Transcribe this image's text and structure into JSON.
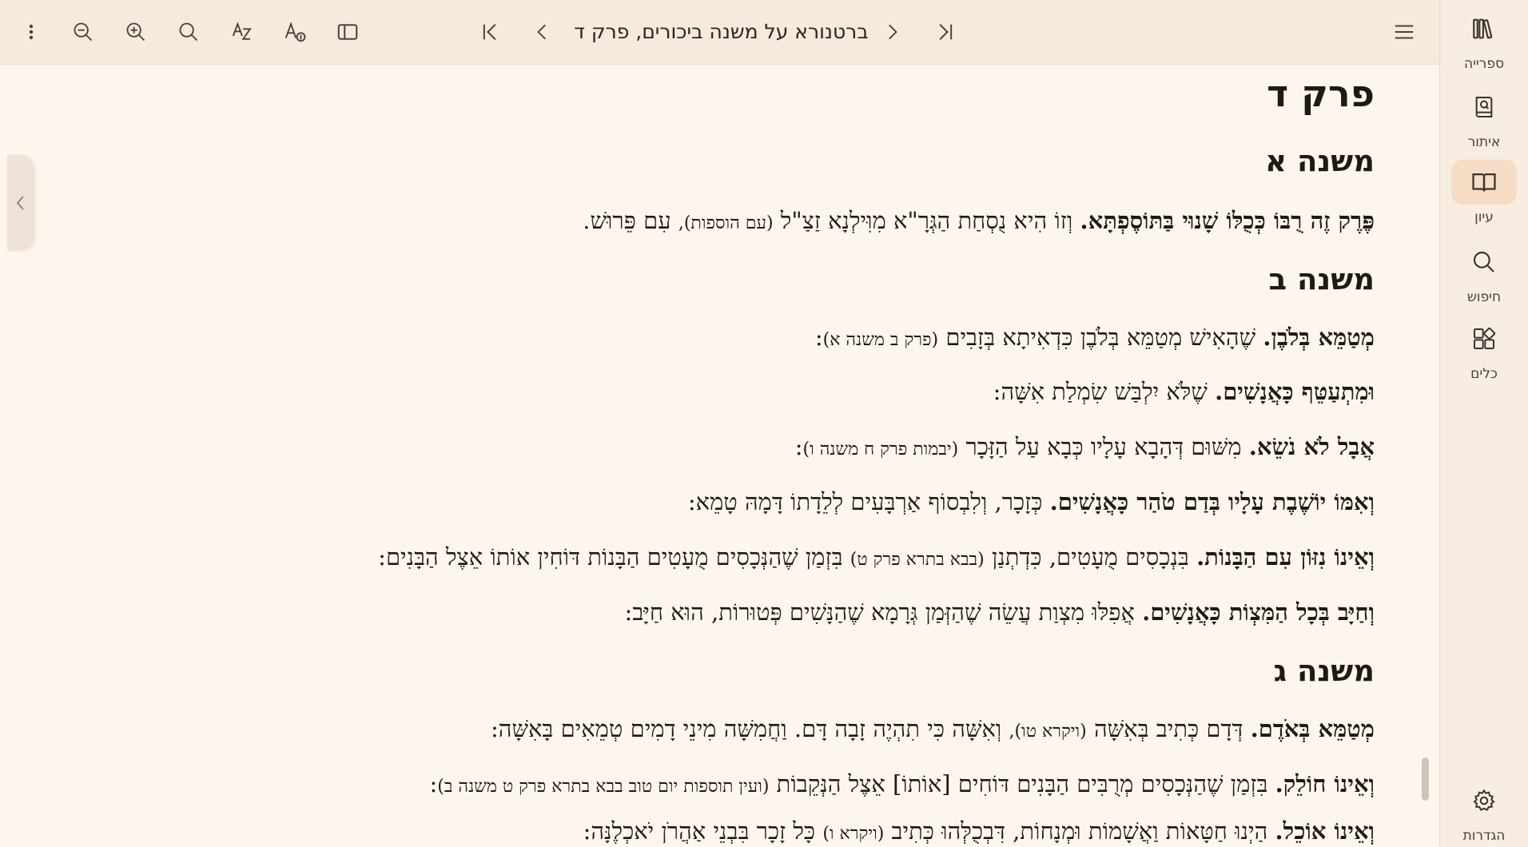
{
  "toolbar": {
    "title": "ברטנורא על משנה ביכורים, פרק ד",
    "buttons": [
      "more-menu",
      "zoom-out",
      "zoom-in",
      "search",
      "spell-tool",
      "font-size",
      "toggle-panel",
      "first-page",
      "previous",
      "next",
      "last-page",
      "hamburger-menu"
    ]
  },
  "sidebar": {
    "items": [
      {
        "label": "ספרייה",
        "icon": "library-icon"
      },
      {
        "label": "איתור",
        "icon": "locate-icon"
      },
      {
        "label": "עיון",
        "icon": "book-open-icon"
      },
      {
        "label": "חיפוש",
        "icon": "search-icon"
      },
      {
        "label": "כלים",
        "icon": "tools-icon"
      },
      {
        "label": "הגדרות",
        "icon": "gear-icon"
      }
    ],
    "active": "עיון"
  },
  "content": {
    "chapter": "פרק ד",
    "sections": [
      {
        "heading": "משנה א",
        "paras": [
          {
            "lead": "פֶּרֶק זֶה רֻבּוֹ כְּכֻלּוֹ שָׁנוּי בַּתּוֹסֶפְתָּא.",
            "text": " וְזוֹ הִיא נֻסְחַת הַגְּרָ\"א מִוִּילְנָא זַצַ\"ל ",
            "ref": "(עם הוספות),",
            "tail": " עִם פֵּרוּשׁ."
          }
        ]
      },
      {
        "heading": "משנה ב",
        "paras": [
          {
            "lead": "מְטַמֵּא בְּלֹבֶן.",
            "text": " שֶׁהָאִישׁ מְטַמֵּא בְּלֹבֶן כִּדְאִיתָא בְּזָבִים ",
            "ref": "(פרק ב משנה א)",
            "tail": ":"
          },
          {
            "lead": "וּמִתְעַטֵּף כָּאֲנָשִׁים.",
            "text": " שֶׁלֹּא יִלְבַּשׁ שִׂמְלַת אִשָּׁה:",
            "ref": "",
            "tail": ""
          },
          {
            "lead": "אֲבָל לֹא נֹשֵׂא.",
            "text": " מִשּׁוּם דְּהָבָא עָלָיו כְּבָא עַל הַזָּכָר ",
            "ref": "(יבמות פרק ח משנה ו)",
            "tail": ":"
          },
          {
            "lead": "וְאִמּוֹ יוֹשֶׁבֶת עָלָיו בְּדַם טֹהַר כָּאֲנָשִׁים.",
            "text": " כְּזָכָר, וְלִבְסוֹף אַרְבָּעִים לְלֵדָתוֹ דָּמָהּ טָמֵא:",
            "ref": "",
            "tail": ""
          },
          {
            "lead": "וְאֵינוֹ נִזּוֹן עִם הַבָּנוֹת.",
            "text": " בִּנְכָסִים מֻעָטִים, כִּדְתְנַן ",
            "ref": "(בבא בתרא פרק ט)",
            "tail": " בִּזְמַן שֶׁהַנְּכָסִים מֻעָטִים הַבָּנוֹת דּוֹחִין אוֹתוֹ אֵצֶל הַבָּנִים:"
          },
          {
            "lead": "וְחַיָּב בְּכָל הַמִּצְוֹת כָּאֲנָשִׁים.",
            "text": " אֲפִלּוּ מִצְוַת עֲשֵׂה שֶׁהַזְּמַן גְּרָמָא שֶׁהַנָּשִׁים פְּטוּרוֹת, הוּא חַיָּב:",
            "ref": "",
            "tail": ""
          }
        ]
      },
      {
        "heading": "משנה ג",
        "paras": [
          {
            "lead": "מְטַמֵּא בְּאֹדֶם.",
            "text": " דְּדָם כְּתִיב בְּאִשָּׁה ",
            "ref": "(ויקרא טו),",
            "tail": " וְאִשָּׁה כִּי תִהְיֶה זָבָה דָּם. וַחֲמִשָּׁה מִינֵי דָמִים טְמֵאִים בָּאִשָּׁה:"
          },
          {
            "lead": "וְאֵינוֹ חוֹלֵק.",
            "text": " בִּזְמַן שֶׁהַנְּכָסִים מְרֻבִּים הַבָּנִים דּוֹחִים [אוֹתוֹ] אֵצֶל הַנְּקֵבוֹת ",
            "ref": "(ועין תוספות יום טוב בבא בתרא פרק ט משנה ב)",
            "tail": ":"
          },
          {
            "lead": "וְאֵינוֹ אוֹכֵל.",
            "text": " הַיְנוּ חַטָּאוֹת וַאֲשָׁמוֹת וּמְנָחוֹת, דִּבְכֻלְּהוּ כְּתִיב ",
            "ref": "(ויקרא ו)",
            "tail": " כָּל זָכָר בִּבְנֵי אַהֲרֹן יֹאכְלֶנָּה:"
          }
        ]
      }
    ]
  },
  "colors": {
    "background": "#fdf6ee",
    "toolbar": "#f6eadc",
    "sidebar": "#f7ede1",
    "active": "#f6dcc4"
  }
}
